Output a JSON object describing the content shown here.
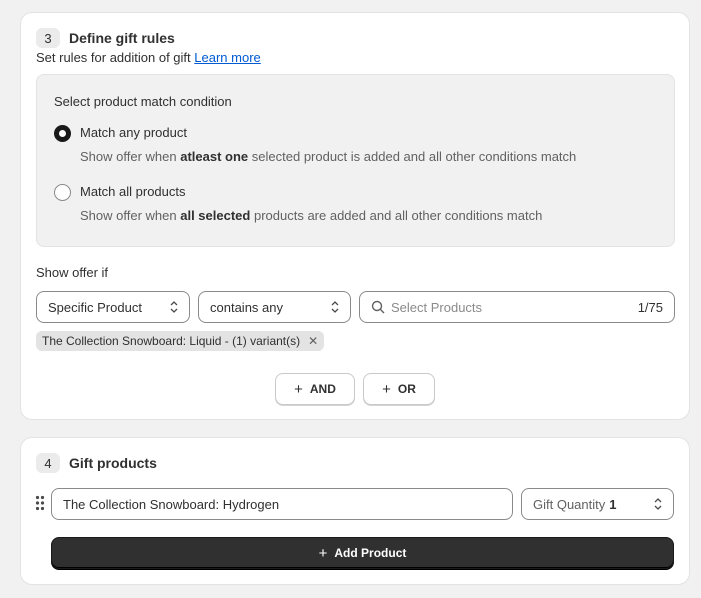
{
  "section3": {
    "step_number": "3",
    "title": "Define gift rules",
    "subtitle": "Set rules for addition of gift",
    "learn_more": "Learn more",
    "match_label": "Select product match condition",
    "options": [
      {
        "title": "Match any product",
        "desc_before": "Show offer when",
        "desc_bold": "atleast one",
        "desc_after": "selected product is added and all other conditions match",
        "selected": true
      },
      {
        "title": "Match all products",
        "desc_before": "Show offer when",
        "desc_bold": "all selected",
        "desc_after": "products are added and all other conditions match",
        "selected": false
      }
    ],
    "show_if_label": "Show offer if",
    "condition_type": "Specific Product",
    "condition_operator": "contains any",
    "search_placeholder": "Select Products",
    "search_count": "1/75",
    "selected_tag": "The Collection Snowboard: Liquid - (1) variant(s)",
    "and_label": "AND",
    "or_label": "OR"
  },
  "section4": {
    "step_number": "4",
    "title": "Gift products",
    "product_value": "The Collection Snowboard: Hydrogen",
    "quantity_label": "Gift Quantity",
    "quantity_value": "1",
    "add_product_label": "Add Product"
  }
}
